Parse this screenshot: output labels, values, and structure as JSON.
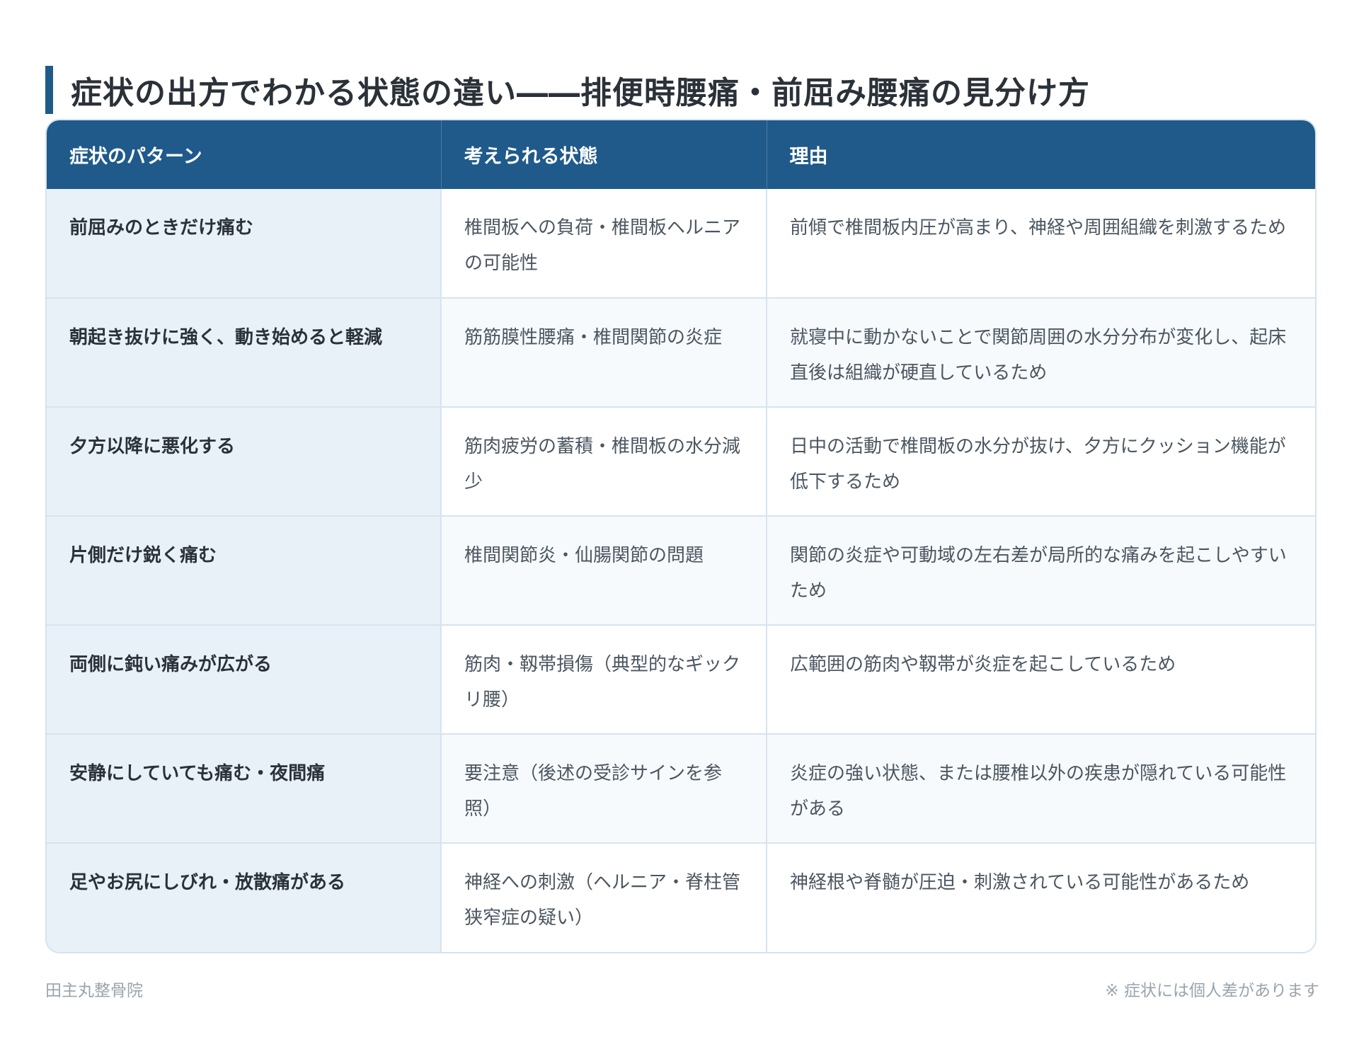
{
  "title": "症状の出方でわかる状態の違い――排便時腰痛・前屈み腰痛の見分け方",
  "table": {
    "headers": [
      "症状のパターン",
      "考えられる状態",
      "理由"
    ],
    "rows": [
      {
        "pattern": "前屈みのときだけ痛む",
        "state": "椎間板への負荷・椎間板ヘルニアの可能性",
        "reason": "前傾で椎間板内圧が高まり、神経や周囲組織を刺激するため"
      },
      {
        "pattern": "朝起き抜けに強く、動き始めると軽減",
        "state": "筋筋膜性腰痛・椎間関節の炎症",
        "reason": "就寝中に動かないことで関節周囲の水分分布が変化し、起床直後は組織が硬直しているため"
      },
      {
        "pattern": "夕方以降に悪化する",
        "state": "筋肉疲労の蓄積・椎間板の水分減少",
        "reason": "日中の活動で椎間板の水分が抜け、夕方にクッション機能が低下するため"
      },
      {
        "pattern": "片側だけ鋭く痛む",
        "state": "椎間関節炎・仙腸関節の問題",
        "reason": "関節の炎症や可動域の左右差が局所的な痛みを起こしやすいため"
      },
      {
        "pattern": "両側に鈍い痛みが広がる",
        "state": "筋肉・靱帯損傷（典型的なギックリ腰）",
        "reason": "広範囲の筋肉や靱帯が炎症を起こしているため"
      },
      {
        "pattern": "安静にしていても痛む・夜間痛",
        "state": "要注意（後述の受診サインを参照）",
        "reason": "炎症の強い状態、または腰椎以外の疾患が隠れている可能性がある"
      },
      {
        "pattern": "足やお尻にしびれ・放散痛がある",
        "state": "神経への刺激（ヘルニア・脊柱管狭窄症の疑い）",
        "reason": "神経根や脊髄が圧迫・刺激されている可能性があるため"
      }
    ]
  },
  "footer": {
    "clinic": "田主丸整骨院",
    "note": "※ 症状には個人差があります"
  },
  "colors": {
    "accent": "#1f5a8a",
    "header_bg": "#1f5a8a",
    "pattern_cell_bg": "#e9f1f8",
    "border": "#d6e4ef"
  }
}
